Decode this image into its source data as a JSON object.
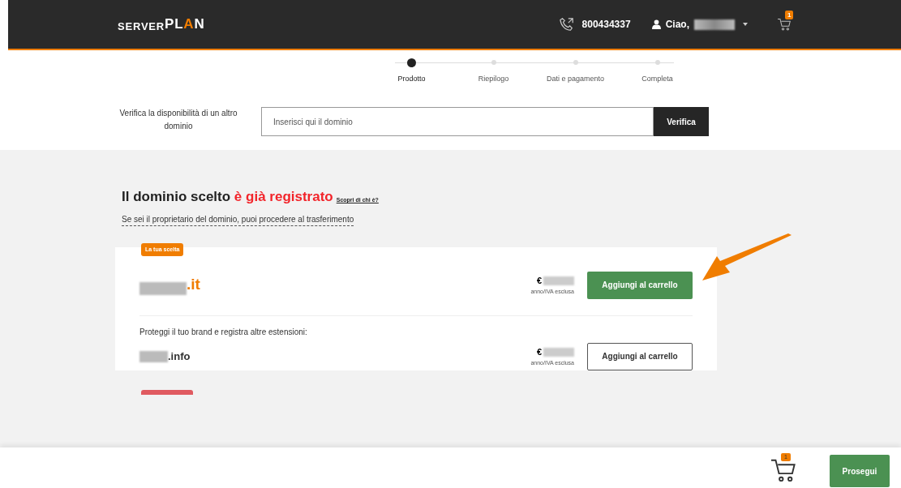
{
  "header": {
    "logo_left": "SERVER",
    "logo_right": "PL",
    "logo_a": "A",
    "logo_end": "N",
    "phone": "800434337",
    "greeting": "Ciao,",
    "cart_count": "1"
  },
  "steps": [
    {
      "label": "Prodotto",
      "selected": true
    },
    {
      "label": "Riepilogo",
      "selected": false
    },
    {
      "label": "Dati e pagamento",
      "selected": false
    },
    {
      "label": "Completa",
      "selected": false
    }
  ],
  "search": {
    "label": "Verifica la disponibilità di un altro dominio",
    "placeholder": "Inserisci qui il dominio",
    "button": "Verifica"
  },
  "result": {
    "title": "Il dominio scelto **è già registrato**",
    "owner_link": "Scopri di chi è?",
    "transfer_link": "Se sei il proprietario del dominio, puoi procedere al trasferimento"
  },
  "choice": {
    "badge": "La tua scelta",
    "extension": ".it",
    "currency": "€",
    "price_note": "anno/IVA esclusa",
    "button": "Aggiungi al carrello",
    "primary": true
  },
  "others_intro": "Proteggi il tuo brand e registra altre estensioni:",
  "others": [
    {
      "extension": ".info",
      "currency": "€",
      "price_note": "anno/IVA esclusa",
      "button": "Aggiungi al carrello",
      "primary": false
    }
  ],
  "footer": {
    "cart_count": "1",
    "button": "Prosegui"
  }
}
